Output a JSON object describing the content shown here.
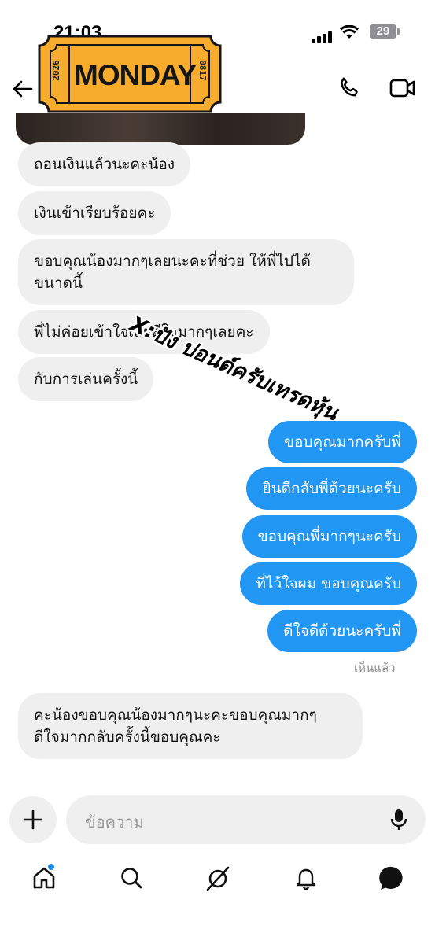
{
  "status_bar": {
    "time": "21:03",
    "battery": "29"
  },
  "sticker": {
    "word": "MONDAY",
    "left_code": "2026",
    "right_code": "0817"
  },
  "watermark": "X:ปัง ปอนด์ครับเทรดหุ้น",
  "received_top": [
    "ถอนเงินแล้วนะคะน้อง",
    "เงินเข้าเรียบร้อยคะ",
    "ขอบคุณน้องมากๆเลยนะคะที่ช่วย ให้พี่ไปได้",
    "ขนาดนี้",
    "พี่ไม่ค่อยเข้าใจเลยดีใจมากๆเลยคะ",
    "กับการเล่นครั้งนี้"
  ],
  "sent": [
    "ขอบคุณมากครับพี่",
    "ยินดีกลับพี่ด้วยนะครับ",
    "ขอบคุณพี่มากๆนะครับ",
    "ที่ไว้ใจผม ขอบคุณครับ",
    "ดีใจดีด้วยนะครับพี่"
  ],
  "seen_label": "เห็นแล้ว",
  "received_bottom": [
    "คะน้องขอบคุณน้องมากๆนะคะขอบคุณมากๆ",
    "ดีใจมากกลับครั้งนี้ขอบคุณคะ"
  ],
  "composer": {
    "placeholder": "ข้อความ"
  },
  "colors": {
    "sent_bubble": "#2196f3",
    "received_bubble": "#efefef",
    "sticker_fill": "#f7ac2e",
    "notification_dot": "#1e88e5"
  }
}
